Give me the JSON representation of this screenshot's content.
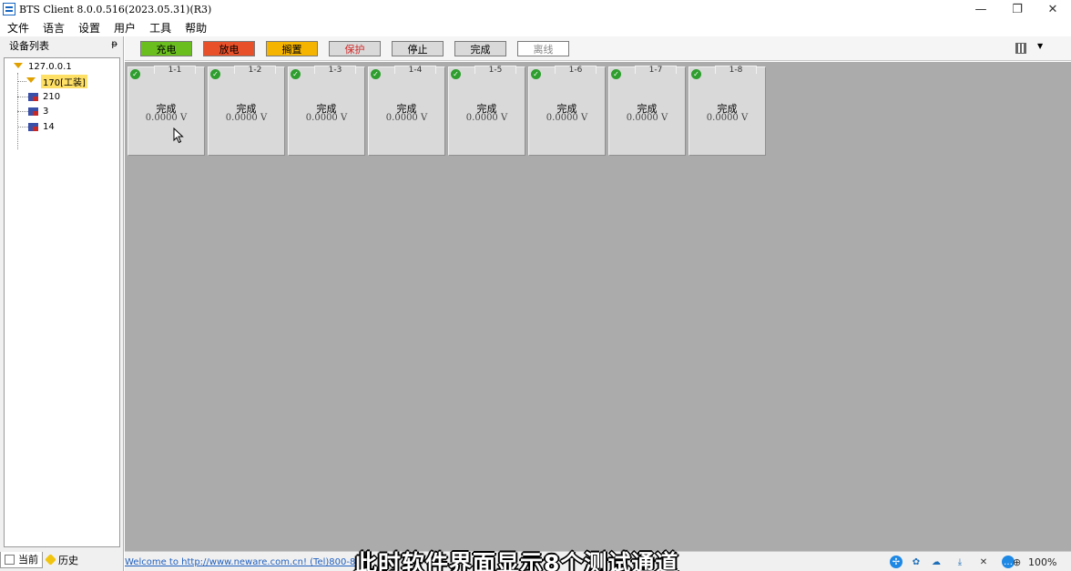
{
  "window": {
    "title": "BTS Client 8.0.0.516(2023.05.31)(R3)",
    "minimize": "—",
    "restore": "❐",
    "close": "✕"
  },
  "menu": [
    "文件",
    "语言",
    "设置",
    "用户",
    "工具",
    "帮助"
  ],
  "left_panel": {
    "title": "设备列表",
    "pin": "ᵽ",
    "tree": {
      "root": "127.0.0.1",
      "children": [
        "170[工装]",
        "210",
        "3",
        "14"
      ]
    },
    "tabs": [
      "当前",
      "历史"
    ]
  },
  "toolbar": {
    "legend": [
      {
        "label": "充电",
        "bg": "#6abf1f",
        "color": "#000000"
      },
      {
        "label": "放电",
        "bg": "#e8502a",
        "color": "#000000"
      },
      {
        "label": "搁置",
        "bg": "#f5b400",
        "color": "#000000"
      },
      {
        "label": "保护",
        "bg": "#d9d9d9",
        "color": "#d62828"
      },
      {
        "label": "停止",
        "bg": "#d9d9d9",
        "color": "#000000"
      },
      {
        "label": "完成",
        "bg": "#d9d9d9",
        "color": "#000000"
      },
      {
        "label": "离线",
        "bg": "#ffffff",
        "color": "#888888"
      }
    ],
    "view_dropdown": "▼"
  },
  "channels": [
    {
      "id": "1-1",
      "status": "完成",
      "voltage": "0.0000 V"
    },
    {
      "id": "1-2",
      "status": "完成",
      "voltage": "0.0000 V"
    },
    {
      "id": "1-3",
      "status": "完成",
      "voltage": "0.0000 V"
    },
    {
      "id": "1-4",
      "status": "完成",
      "voltage": "0.0000 V"
    },
    {
      "id": "1-5",
      "status": "完成",
      "voltage": "0.0000 V"
    },
    {
      "id": "1-6",
      "status": "完成",
      "voltage": "0.0000 V"
    },
    {
      "id": "1-7",
      "status": "完成",
      "voltage": "0.0000 V"
    },
    {
      "id": "1-8",
      "status": "完成",
      "voltage": "0.0000 V"
    }
  ],
  "statusbar": {
    "welcome": "Welcome to http://www.neware.com.cn! (Tel)800-8",
    "caption": "此时软件界面显示8个测试通道",
    "zoom": "100%",
    "zoom_icon": "⊕",
    "tray_icons": [
      "fan-icon",
      "pinwheel-icon",
      "cloud-icon",
      "download-icon",
      "speaker-muted-icon",
      "chat-icon"
    ]
  }
}
